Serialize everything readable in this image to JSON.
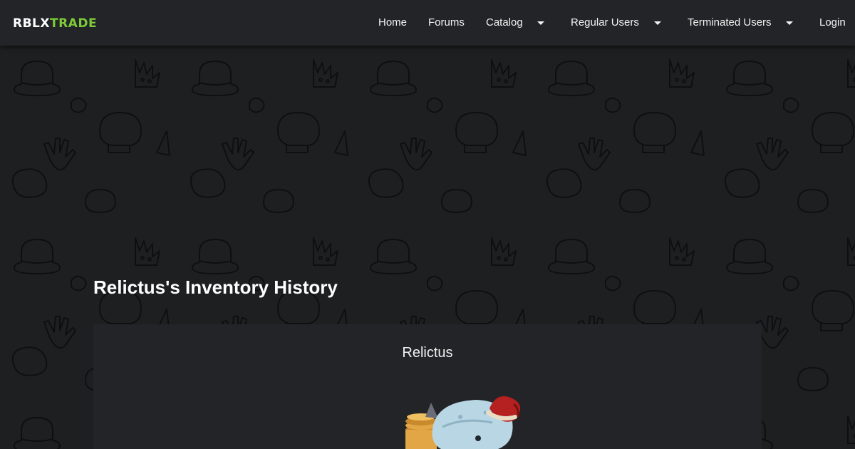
{
  "navbar": {
    "brand_part1": "RBLX",
    "brand_part2": "TRADE",
    "items": [
      {
        "label": "Home"
      },
      {
        "label": "Forums"
      },
      {
        "label": "Catalog"
      },
      {
        "label": "Regular Users"
      },
      {
        "label": "Terminated Users"
      },
      {
        "label": "Login"
      }
    ]
  },
  "page": {
    "title": "Relictus's Inventory History"
  },
  "profile": {
    "username": "Relictus"
  },
  "colors": {
    "navbar_bg": "#222427",
    "page_bg": "#1c1d1f",
    "card_bg": "#222427",
    "brand_accent": "#7dc93a",
    "text": "#ffffff"
  },
  "icons": [
    "dropdown-caret-icon",
    "background-pattern",
    "avatar-image"
  ]
}
